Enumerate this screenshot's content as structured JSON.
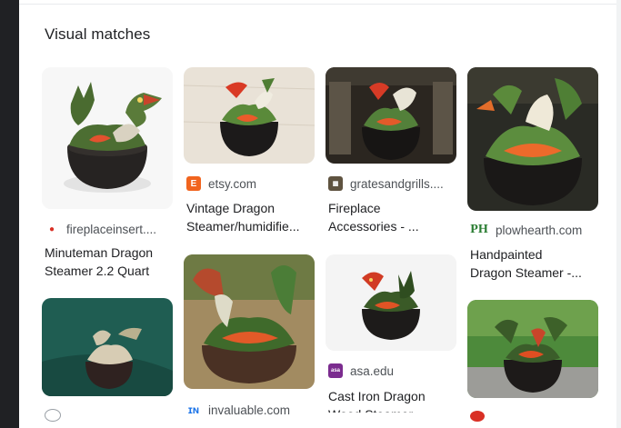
{
  "heading": "Visual matches",
  "cards": [
    {
      "source": "fireplaceinsert....",
      "title_line1": "Minuteman Dragon",
      "title_line2": "Steamer 2.2 Quart",
      "favicon_color": "#ffffff",
      "favicon_glyph": "📍"
    },
    {
      "source": "etsy.com",
      "title_line1": "Vintage Dragon",
      "title_line2": "Steamer/humidifie...",
      "favicon_color": "#f1641e",
      "favicon_glyph": "E"
    },
    {
      "source": "gratesandgrills....",
      "title_line1": "Fireplace",
      "title_line2": "Accessories - ...",
      "favicon_color": "#5f5340",
      "favicon_glyph": "▦"
    },
    {
      "source": "plowhearth.com",
      "title_line1": "Handpainted",
      "title_line2": "Dragon Steamer -...",
      "favicon_color": "#ffffff",
      "favicon_glyph": "PH"
    },
    {
      "source": "invaluable.com",
      "title_line1": "",
      "title_line2": "",
      "favicon_color": "#ffffff",
      "favicon_glyph": ""
    },
    {
      "source": "asa.edu",
      "title_line1": "Cast Iron Dragon",
      "title_line2": "Wood Steamer",
      "favicon_color": "#7b2c8f",
      "favicon_glyph": "asa"
    }
  ],
  "colors": {
    "background": "#ffffff",
    "text": "#202124",
    "secondary_text": "#4d5156",
    "thumb_bg": "#f1f3f4"
  }
}
